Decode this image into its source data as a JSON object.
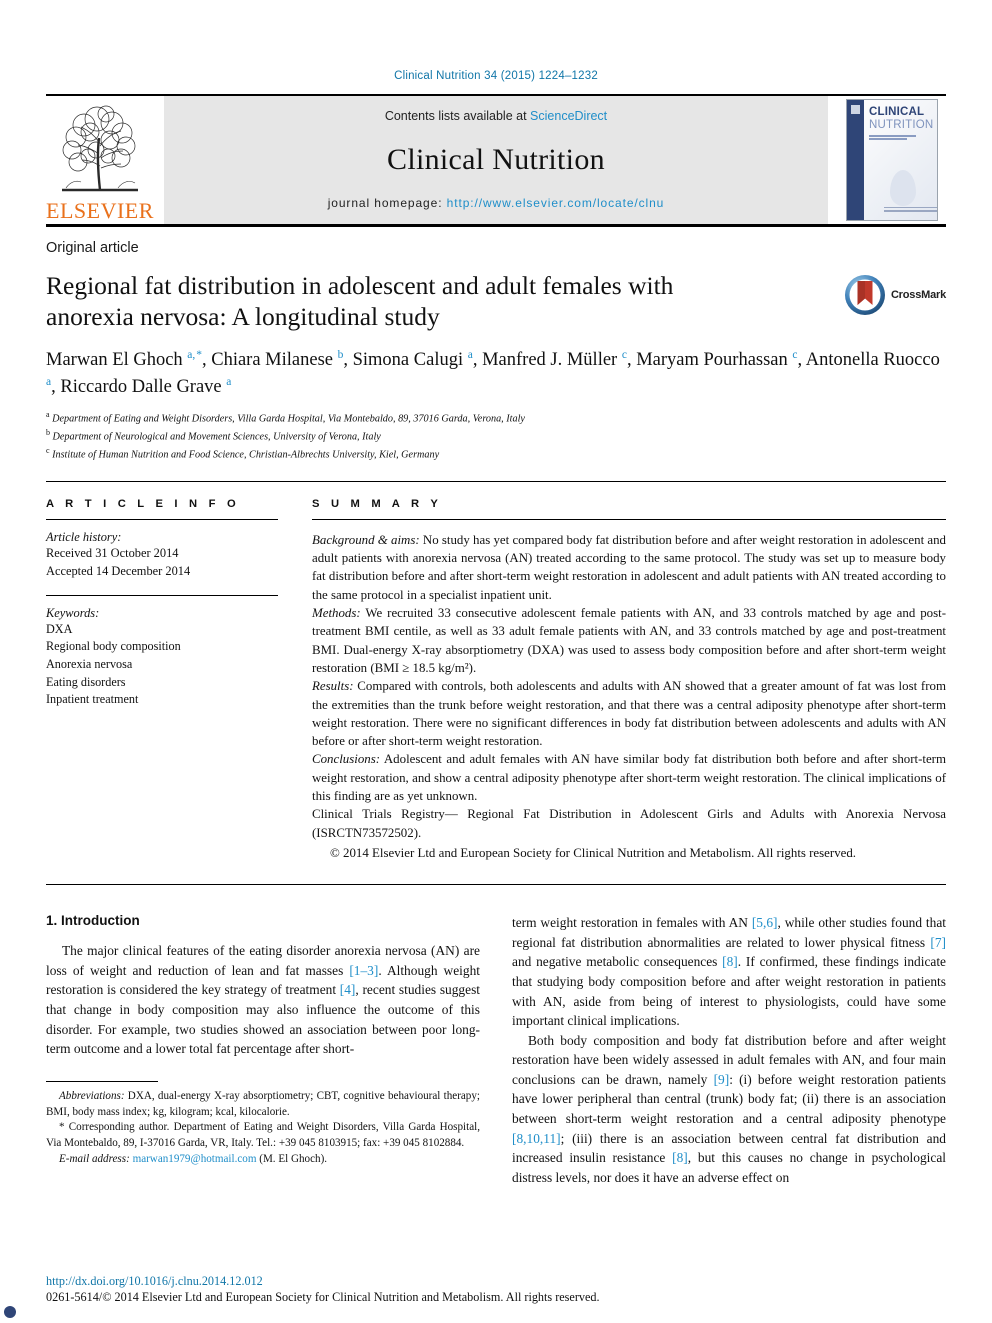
{
  "running_head": "Clinical Nutrition 34 (2015) 1224–1232",
  "masthead": {
    "publisher": "ELSEVIER",
    "contents_prefix": "Contents lists available at",
    "sciencedirect": "ScienceDirect",
    "journal_name": "Clinical Nutrition",
    "homepage_label": "journal homepage:",
    "homepage_url": "http://www.elsevier.com/locate/clnu",
    "cover": {
      "line1": "CLINICAL",
      "line2": "NUTRITION"
    },
    "accent_blue": "#1f8ec9",
    "elsevier_orange": "#E9711C",
    "band_gray": "#e6e6e6"
  },
  "article": {
    "type": "Original article",
    "title": "Regional fat distribution in adolescent and adult females with anorexia nervosa: A longitudinal study",
    "crossmark_label": "CrossMark",
    "authors_html": "Marwan El Ghoch <sup>a,&#8202;*</sup>, Chiara Milanese <sup>b</sup>, Simona Calugi <sup>a</sup>, Manfred J. Müller <sup>c</sup>, Maryam Pourhassan <sup>c</sup>, Antonella Ruocco <sup>a</sup>, Riccardo Dalle Grave <sup>a</sup>",
    "affiliations": [
      {
        "mark": "a",
        "text": "Department of Eating and Weight Disorders, Villa Garda Hospital, Via Montebaldo, 89, 37016 Garda, Verona, Italy"
      },
      {
        "mark": "b",
        "text": "Department of Neurological and Movement Sciences, University of Verona, Italy"
      },
      {
        "mark": "c",
        "text": "Institute of Human Nutrition and Food Science, Christian-Albrechts University, Kiel, Germany"
      }
    ]
  },
  "article_info": {
    "heading": "A R T I C L E  I N F O",
    "history_label": "Article history:",
    "received": "Received 31 October 2014",
    "accepted": "Accepted 14 December 2014",
    "keywords_label": "Keywords:",
    "keywords": [
      "DXA",
      "Regional body composition",
      "Anorexia nervosa",
      "Eating disorders",
      "Inpatient treatment"
    ]
  },
  "summary": {
    "heading": "S U M M A R Y",
    "background_label": "Background & aims:",
    "background_text": " No study has yet compared body fat distribution before and after weight restoration in adolescent and adult patients with anorexia nervosa (AN) treated according to the same protocol. The study was set up to measure body fat distribution before and after short-term weight restoration in adolescent and adult patients with AN treated according to the same protocol in a specialist inpatient unit.",
    "methods_label": "Methods:",
    "methods_text": " We recruited 33 consecutive adolescent female patients with AN, and 33 controls matched by age and post-treatment BMI centile, as well as 33 adult female patients with AN, and 33 controls matched by age and post-treatment BMI. Dual-energy X-ray absorptiometry (DXA) was used to assess body composition before and after short-term weight restoration (BMI ≥ 18.5 kg/m²).",
    "results_label": "Results:",
    "results_text": " Compared with controls, both adolescents and adults with AN showed that a greater amount of fat was lost from the extremities than the trunk before weight restoration, and that there was a central adiposity phenotype after short-term weight restoration. There were no significant differences in body fat distribution between adolescents and adults with AN before or after short-term weight restoration.",
    "conclusions_label": "Conclusions:",
    "conclusions_text": " Adolescent and adult females with AN have similar body fat distribution both before and after short-term weight restoration, and show a central adiposity phenotype after short-term weight restoration. The clinical implications of this finding are as yet unknown.",
    "registry_text": "Clinical Trials Registry— Regional Fat Distribution in Adolescent Girls and Adults with Anorexia Nervosa (ISRCTN73572502).",
    "copyright": "© 2014 Elsevier Ltd and European Society for Clinical Nutrition and Metabolism. All rights reserved."
  },
  "body": {
    "section_heading": "1. Introduction",
    "left_paragraph_html": "The major clinical features of the eating disorder anorexia nervosa (AN) are loss of weight and reduction of lean and fat masses <span class=\"ref\">[1–3]</span>. Although weight restoration is considered the key strategy of treatment <span class=\"ref\">[4]</span>, recent studies suggest that change in body composition may also influence the outcome of this disorder. For example, two studies showed an association between poor long-term outcome and a lower total fat percentage after short-",
    "right_paragraph1_html": "term weight restoration in females with AN <span class=\"ref\">[5,6]</span>, while other studies found that regional fat distribution abnormalities are related to lower physical fitness <span class=\"ref\">[7]</span> and negative metabolic consequences <span class=\"ref\">[8]</span>. If confirmed, these findings indicate that studying body composition before and after weight restoration in patients with AN, aside from being of interest to physiologists, could have some important clinical implications.",
    "right_paragraph2_html": "Both body composition and body fat distribution before and after weight restoration have been widely assessed in adult females with AN, and four main conclusions can be drawn, namely <span class=\"ref\">[9]</span>: (i) before weight restoration patients have lower peripheral than central (trunk) body fat; (ii) there is an association between short-term weight restoration and a central adiposity phenotype <span class=\"ref\">[8,10,11]</span>; (iii) there is an association between central fat distribution and increased insulin resistance <span class=\"ref\">[8]</span>, but this causes no change in psychological distress levels, nor does it have an adverse effect on"
  },
  "footnotes": {
    "abbrev_label": "Abbreviations:",
    "abbrev_text": " DXA, dual-energy X-ray absorptiometry; CBT, cognitive behavioural therapy; BMI, body mass index; kg, kilogram; kcal, kilocalorie.",
    "corresponding": "* Corresponding author. Department of Eating and Weight Disorders, Villa Garda Hospital, Via Montebaldo, 89, I-37016 Garda, VR, Italy. Tel.: +39 045 8103915; fax: +39 045 8102884.",
    "email_label": "E-mail address:",
    "email": "marwan1979@hotmail.com",
    "email_owner": "(M. El Ghoch).",
    "doi": "http://dx.doi.org/10.1016/j.clnu.2014.12.012",
    "issn_line": "0261-5614/© 2014 Elsevier Ltd and European Society for Clinical Nutrition and Metabolism. All rights reserved."
  }
}
